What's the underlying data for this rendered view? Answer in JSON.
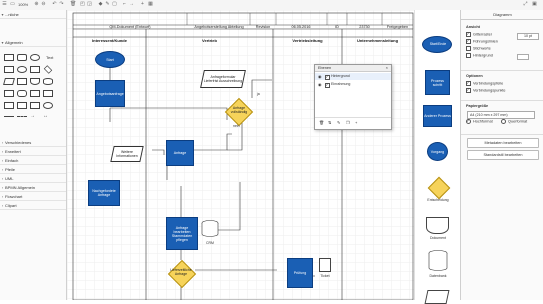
{
  "toolbar": {
    "zoom": "100%",
    "icons": [
      "menu-icon",
      "page-view-icon",
      "zoom-in-icon",
      "zoom-out-icon",
      "undo-icon",
      "redo-icon",
      "delete-icon",
      "to-front-icon",
      "to-back-icon",
      "fill-color-icon",
      "line-color-icon",
      "shadow-icon",
      "waypoints-icon",
      "plus-icon",
      "table-icon",
      "fullscreen-icon",
      "format-panel-icon"
    ]
  },
  "sidebar": {
    "search_label": "...nliche",
    "general_label": "Allgemein",
    "text_label": "Text",
    "categories": [
      "Verschiedenes",
      "Erweitert",
      "Einfach",
      "Pfeile",
      "UML",
      "BPMN Allgemein",
      "Flowchart",
      "Clipart"
    ]
  },
  "sheet_header": {
    "doc": "QM-Dokument (Entwurf)",
    "dept": "Angebotserstellung Abteilung",
    "revision": "Revision",
    "date": "06.05.2016",
    "id_label": "ID",
    "id": "23730",
    "status": "Freigegeben"
  },
  "lanes": [
    "Interessent/Kunde",
    "Vertrieb",
    "Vertriebsleitung",
    "Unternehmensleitung"
  ],
  "nodes": {
    "start": "Start",
    "request": "Angebotsanfrage",
    "form": "Anfrageformular Lieferfrist Ausschreibung",
    "check": "Anfrage vollständig",
    "inquiry": "Anfrage",
    "further_info": "Weitere Informationen",
    "followup": "Nachgefordete Anfrage",
    "create_offer": "Anfrage bearbeiten Stammdaten pflegen",
    "crm": "CRM",
    "approval": "Lieferzeitliche Anfrage",
    "prepare": "Prüfung",
    "ticket": "Ticket",
    "yes": "ja",
    "no": "nein"
  },
  "layers_panel": {
    "title": "Ebenen",
    "layers": [
      {
        "name": "Hintergrund",
        "checked": true
      },
      {
        "name": "Einrahmung",
        "checked": true
      }
    ]
  },
  "shapes_panel": {
    "items": [
      "Start/Ende",
      "Prozess schritt",
      "Anderer Prozess",
      "Vorgang",
      "Entscheidung",
      "Dokument",
      "Datenbank",
      "Daten"
    ]
  },
  "format_panel": {
    "tab": "Diagramm",
    "view_section": "Ansicht",
    "grid_label": "Gitterraster",
    "grid_value": "10 pt",
    "guides_label": "Führungslinien",
    "tooltips_label": "Stichworte",
    "bg_label": "Hintergrund",
    "options_section": "Optionen",
    "connection_arrows": "Verbindungspfeile",
    "connection_points": "Verbindungspunkte",
    "paper_section": "Papiergröße",
    "paper_size": "A4 (210 mm x 297 mm)",
    "portrait": "Hochformat",
    "landscape": "Querformat",
    "edit_data_btn": "Metadaten bearbeiten",
    "edit_style_btn": "Standardstil bearbeiten"
  }
}
